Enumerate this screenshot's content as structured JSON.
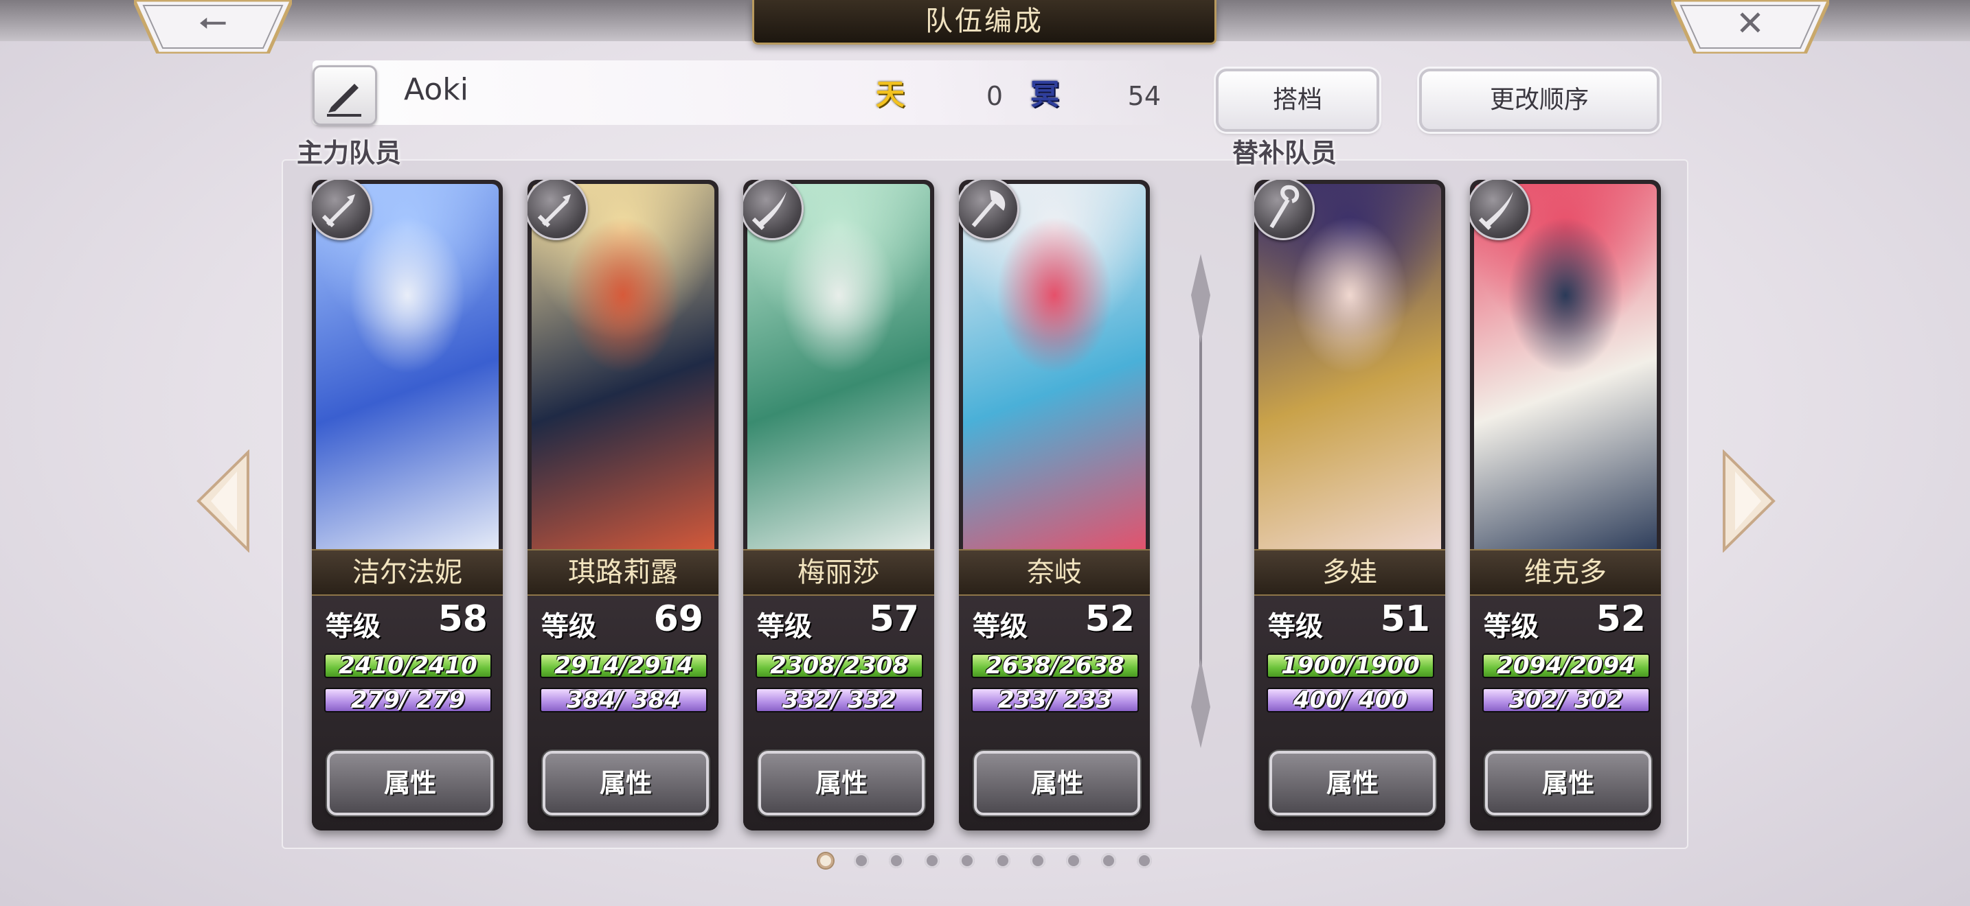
{
  "header": {
    "title": "队伍编成",
    "back_icon": "arrow-left-icon",
    "close_icon": "close-icon"
  },
  "player": {
    "name": "Aoki",
    "ten_label": "天",
    "ten_value": "0",
    "ming_label": "冥",
    "ming_value": "54"
  },
  "buttons": {
    "partner": "搭档",
    "change_order": "更改顺序"
  },
  "sections": {
    "main": "主力队员",
    "reserve": "替补队员"
  },
  "level_label": "等级",
  "attr_label": "属性",
  "colors": {
    "hp": "#6bc23a",
    "mp": "#b38ee6",
    "gold": "#f3c21f",
    "nameplate": "#f2e4bf"
  },
  "members": [
    {
      "name": "洁尔法妮",
      "level": "58",
      "hp": "2410/2410",
      "mp": " 279/  279",
      "weapon": "sword-icon",
      "hp_ratio": 1,
      "mp_ratio": 1,
      "palette": [
        "#a8c8ff",
        "#3a5fd0",
        "#e9eef8"
      ]
    },
    {
      "name": "琪路莉露",
      "level": "69",
      "hp": "2914/2914",
      "mp": " 384/  384",
      "weapon": "sword-icon",
      "hp_ratio": 1,
      "mp_ratio": 1,
      "palette": [
        "#f2dca0",
        "#1f2a45",
        "#d75a3a"
      ]
    },
    {
      "name": "梅丽莎",
      "level": "57",
      "hp": "2308/2308",
      "mp": " 332/  332",
      "weapon": "blade-icon",
      "hp_ratio": 1,
      "mp_ratio": 1,
      "palette": [
        "#bfe8d2",
        "#3a8c70",
        "#e8eeea"
      ]
    },
    {
      "name": "奈岐",
      "level": "52",
      "hp": "2638/2638",
      "mp": " 233/  233",
      "weapon": "axe-icon",
      "hp_ratio": 1,
      "mp_ratio": 1,
      "palette": [
        "#eef0f4",
        "#4ab0d8",
        "#e6506a"
      ]
    },
    {
      "name": "多娃",
      "level": "51",
      "hp": "1900/1900",
      "mp": " 400/  400",
      "weapon": "staff-icon",
      "hp_ratio": 1,
      "mp_ratio": 1,
      "palette": [
        "#3a2f6a",
        "#c9a24a",
        "#f0d8d0"
      ]
    },
    {
      "name": "维克多",
      "level": "52",
      "hp": "2094/2094",
      "mp": " 302/  302",
      "weapon": "blade-icon",
      "hp_ratio": 1,
      "mp_ratio": 1,
      "palette": [
        "#e8506a",
        "#f2efe8",
        "#2a3a58"
      ]
    }
  ],
  "pagination": {
    "total": 10,
    "active": 0
  }
}
